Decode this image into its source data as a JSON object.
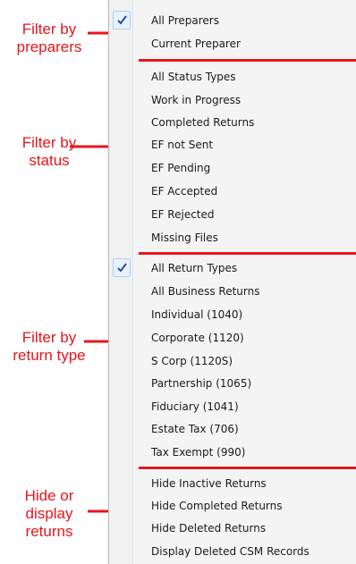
{
  "annotations": {
    "preparers": [
      "Filter by",
      "preparers"
    ],
    "status": [
      "Filter by",
      "status"
    ],
    "return_type": [
      "Filter by",
      "return type"
    ],
    "hide": [
      "Hide or",
      "display",
      "returns"
    ]
  },
  "menu": {
    "preparers": [
      {
        "label": "All Preparers",
        "checked": true
      },
      {
        "label": "Current Preparer",
        "checked": false
      }
    ],
    "status": [
      {
        "label": "All Status Types"
      },
      {
        "label": "Work in Progress"
      },
      {
        "label": "Completed Returns"
      },
      {
        "label": "EF not Sent"
      },
      {
        "label": "EF Pending"
      },
      {
        "label": "EF Accepted"
      },
      {
        "label": "EF Rejected"
      },
      {
        "label": "Missing Files"
      }
    ],
    "return_types": [
      {
        "label": "All Return Types",
        "checked": true
      },
      {
        "label": "All Business Returns"
      },
      {
        "label": "Individual (1040)"
      },
      {
        "label": "Corporate (1120)"
      },
      {
        "label": "S Corp (1120S)"
      },
      {
        "label": "Partnership (1065)"
      },
      {
        "label": "Fiduciary (1041)"
      },
      {
        "label": "Estate Tax (706)"
      },
      {
        "label": "Tax Exempt (990)"
      }
    ],
    "display": [
      {
        "label": "Hide Inactive Returns"
      },
      {
        "label": "Hide Completed Returns"
      },
      {
        "label": "Hide Deleted Returns"
      },
      {
        "label": "Display Deleted CSM Records"
      }
    ]
  },
  "colors": {
    "annotation": "#e8141c",
    "check": "#1f4fa8"
  },
  "icons": {
    "check": "checkmark-icon"
  }
}
